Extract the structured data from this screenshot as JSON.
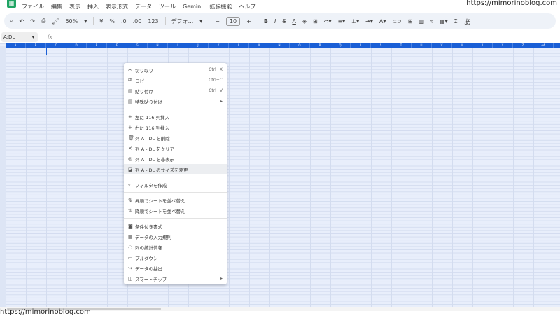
{
  "menubar": {
    "items": [
      "ファイル",
      "編集",
      "表示",
      "挿入",
      "表示形式",
      "データ",
      "ツール",
      "Gemini",
      "拡張機能",
      "ヘルプ"
    ]
  },
  "watermark": "https://mimorinoblog.com",
  "toolbar": {
    "zoom": "50%",
    "currency": "¥",
    "percent": "%",
    "dec_dec": ".0",
    "inc_dec": ".00",
    "number_format": "123",
    "font": "デフォ...",
    "font_size": "10",
    "bold": "B",
    "italic": "I",
    "input_tools": "あ"
  },
  "formula_bar": {
    "name_box": "A:DL",
    "fx": "fx"
  },
  "columns": [
    "A",
    "B",
    "C",
    "D",
    "E",
    "F",
    "G",
    "H",
    "I",
    "J",
    "K",
    "L",
    "M",
    "N",
    "O",
    "P",
    "Q",
    "R",
    "S",
    "T",
    "U",
    "V",
    "W",
    "X",
    "Y",
    "Z",
    "AA"
  ],
  "context_menu": {
    "items": [
      {
        "icon": "scissors-icon",
        "glyph": "✂",
        "label": "切り取り",
        "shortcut": "Ctrl+X"
      },
      {
        "icon": "copy-icon",
        "glyph": "⧉",
        "label": "コピー",
        "shortcut": "Ctrl+C"
      },
      {
        "icon": "paste-icon",
        "glyph": "▤",
        "label": "貼り付け",
        "shortcut": "Ctrl+V"
      },
      {
        "icon": "paste-special-icon",
        "glyph": "▤",
        "label": "特殊貼り付け",
        "shortcut": "▸"
      },
      {
        "icon": "plus-icon",
        "glyph": "+",
        "label": "左に 116 列挿入"
      },
      {
        "icon": "plus-icon",
        "glyph": "+",
        "label": "右に 116 列挿入"
      },
      {
        "icon": "trash-icon",
        "glyph": "🗑",
        "label": "列 A - DL を削除"
      },
      {
        "icon": "close-icon",
        "glyph": "✕",
        "label": "列 A - DL をクリア"
      },
      {
        "icon": "hide-icon",
        "glyph": "◎",
        "label": "列 A - DL を非表示"
      },
      {
        "icon": "resize-icon",
        "glyph": "◪",
        "label": "列 A - DL のサイズを変更"
      },
      {
        "icon": "filter-icon",
        "glyph": "▿",
        "label": "フィルタを作成"
      },
      {
        "icon": "sort-asc-icon",
        "glyph": "⇅",
        "label": "昇順でシートを並べ替え"
      },
      {
        "icon": "sort-desc-icon",
        "glyph": "⇅",
        "label": "降順でシートを並べ替え"
      },
      {
        "icon": "paint-icon",
        "glyph": "◙",
        "label": "条件付き書式"
      },
      {
        "icon": "validation-icon",
        "glyph": "▦",
        "label": "データの入力規則"
      },
      {
        "icon": "bulb-icon",
        "glyph": "◌",
        "label": "列の統計情報"
      },
      {
        "icon": "dropdown-icon",
        "glyph": "▭",
        "label": "プルダウン"
      },
      {
        "icon": "extract-icon",
        "glyph": "↪",
        "label": "データの抽出"
      },
      {
        "icon": "smart-chip-icon",
        "glyph": "◫",
        "label": "スマートチップ",
        "shortcut": "▸"
      }
    ]
  }
}
